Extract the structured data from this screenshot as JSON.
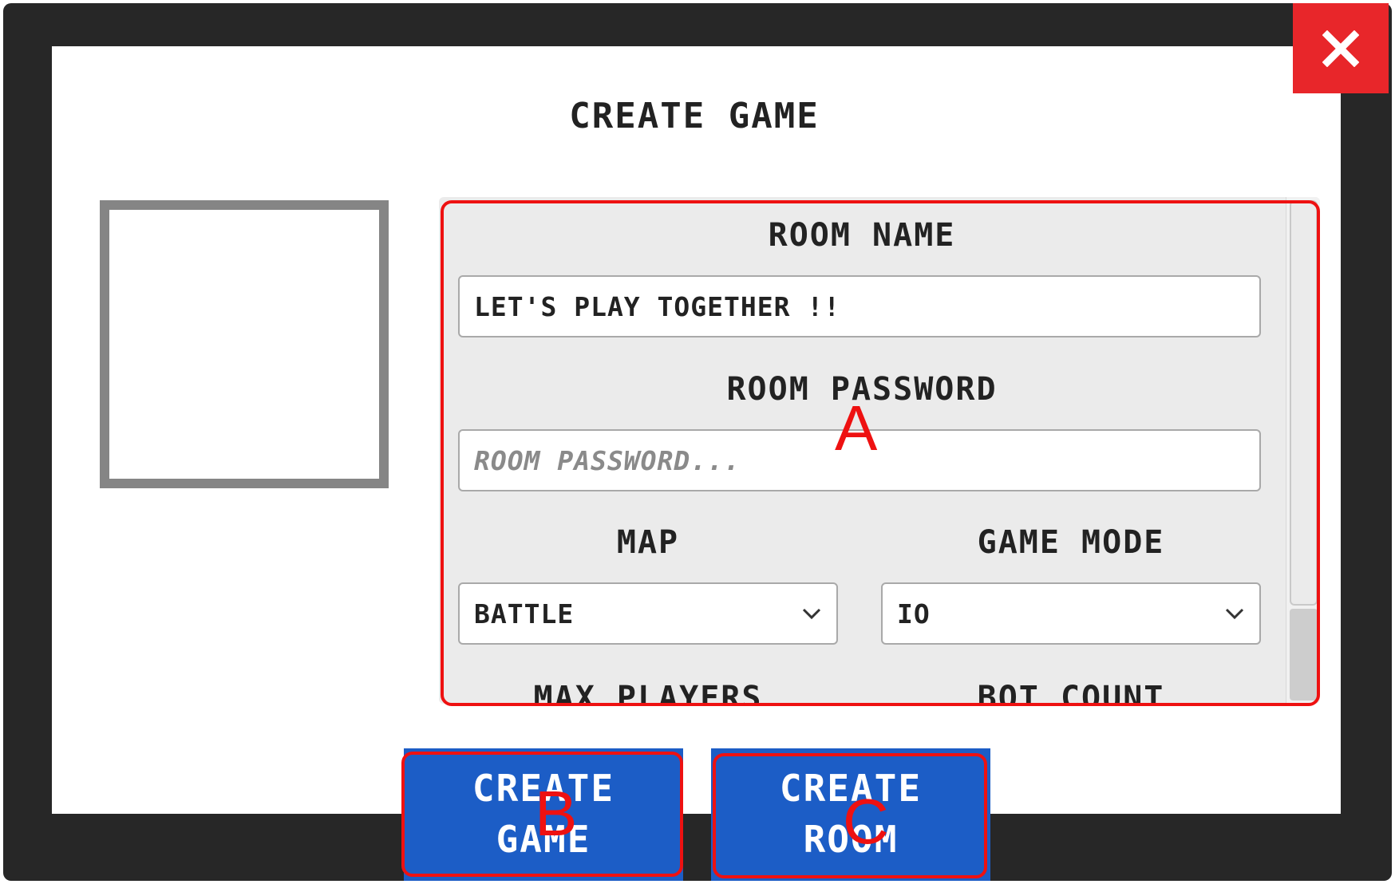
{
  "dialog": {
    "title": "CREATE GAME",
    "close_icon": "close-x-icon"
  },
  "form": {
    "room_name_label": "ROOM NAME",
    "room_name_value": "LET'S PLAY TOGETHER !!",
    "room_password_label": "ROOM PASSWORD",
    "room_password_placeholder": "ROOM PASSWORD...",
    "map_label": "MAP",
    "map_value": "BATTLE",
    "game_mode_label": "GAME MODE",
    "game_mode_value": "IO",
    "max_players_label": "MAX PLAYERS",
    "bot_count_label": "BOT COUNT"
  },
  "buttons": {
    "create_game_line1": "CREATE",
    "create_game_line2": "GAME",
    "create_room_line1": "CREATE",
    "create_room_line2": "ROOM"
  },
  "annotations": {
    "a": "A",
    "b": "B",
    "c": "C"
  },
  "colors": {
    "frame": "#272727",
    "close": "#e8262a",
    "button": "#1c5dc6",
    "annotation": "#ee1111"
  }
}
